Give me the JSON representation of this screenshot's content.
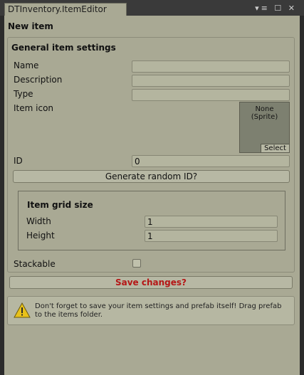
{
  "tab": {
    "title": "DTInventory.ItemEditor",
    "controls": [
      "menu-icon",
      "maximize-icon",
      "close-icon"
    ]
  },
  "editor": {
    "header": "New item",
    "general": {
      "title": "General item settings",
      "name_label": "Name",
      "name_value": "",
      "description_label": "Description",
      "description_value": "",
      "type_label": "Type",
      "type_value": "",
      "icon_label": "Item icon",
      "icon_none": "None\n(Sprite)",
      "icon_select": "Select",
      "id_label": "ID",
      "id_value": "0",
      "generate_button": "Generate random ID?",
      "grid": {
        "title": "Item grid size",
        "width_label": "Width",
        "width_value": "1",
        "height_label": "Height",
        "height_value": "1"
      },
      "stackable_label": "Stackable",
      "stackable_checked": false
    },
    "save_button": "Save changes?",
    "help": {
      "text": "Don't forget to save your item settings and prefab itself! Drag prefab to the items folder.",
      "icon": "warning-icon"
    }
  },
  "colors": {
    "panel": "#a9a994",
    "field": "#b4b59f",
    "save_text": "#b51616",
    "dark_bg": "#2b2b2b"
  }
}
